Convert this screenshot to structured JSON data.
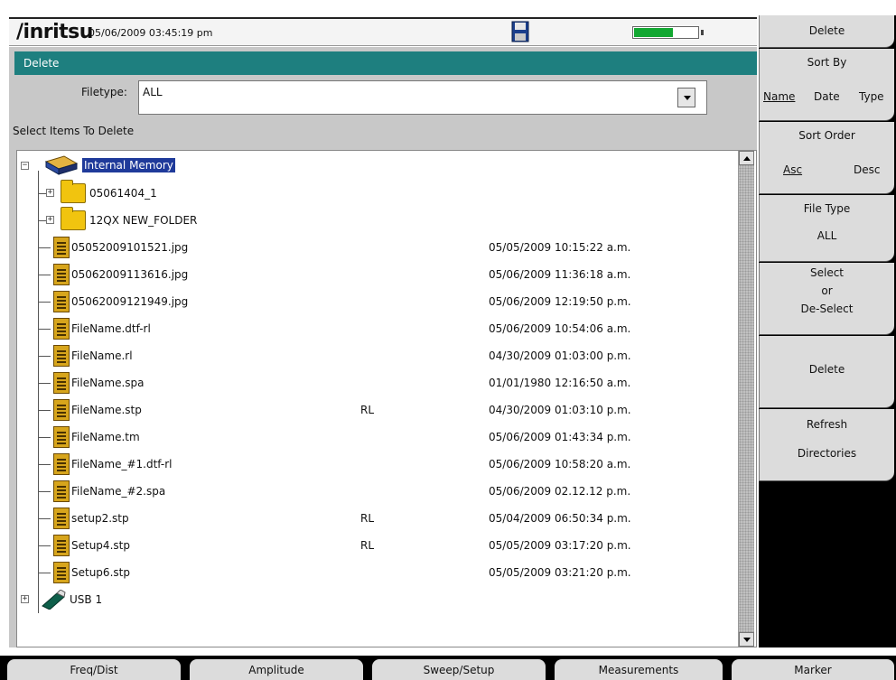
{
  "status": {
    "brand": "/inritsu",
    "datetime": "05/06/2009 03:45:19 pm",
    "battery_level_percent": 62
  },
  "header": {
    "title": "Delete",
    "filetype_label": "Filetype:",
    "filetype_value": "ALL",
    "select_prompt": "Select Items To Delete"
  },
  "tree": {
    "root": "Internal Memory",
    "folders": [
      "05061404_1",
      "12QX NEW_FOLDER"
    ],
    "files": [
      {
        "name": "05052009101521.jpg",
        "type": "",
        "date": "05/05/2009 10:15:22 a.m."
      },
      {
        "name": "05062009113616.jpg",
        "type": "",
        "date": "05/06/2009 11:36:18 a.m."
      },
      {
        "name": "05062009121949.jpg",
        "type": "",
        "date": "05/06/2009 12:19:50 p.m."
      },
      {
        "name": "FileName.dtf-rl",
        "type": "",
        "date": "05/06/2009 10:54:06 a.m."
      },
      {
        "name": "FileName.rl",
        "type": "",
        "date": "04/30/2009 01:03:00 p.m."
      },
      {
        "name": "FileName.spa",
        "type": "",
        "date": "01/01/1980 12:16:50 a.m."
      },
      {
        "name": "FileName.stp",
        "type": "RL",
        "date": "04/30/2009 01:03:10 p.m."
      },
      {
        "name": "FileName.tm",
        "type": "",
        "date": "05/06/2009 01:43:34 p.m."
      },
      {
        "name": "FileName_#1.dtf-rl",
        "type": "",
        "date": "05/06/2009 10:58:20 a.m."
      },
      {
        "name": "FileName_#2.spa",
        "type": "",
        "date": "05/06/2009 02.12.12 p.m."
      },
      {
        "name": "setup2.stp",
        "type": "RL",
        "date": "05/04/2009 06:50:34 p.m."
      },
      {
        "name": "Setup4.stp",
        "type": "RL",
        "date": "05/05/2009 03:17:20 p.m."
      },
      {
        "name": "Setup6.stp",
        "type": "",
        "date": "05/05/2009 03:21:20 p.m."
      }
    ],
    "usb": "USB 1"
  },
  "softkeys": {
    "delete_title": "Delete",
    "sort_by": {
      "title": "Sort By",
      "options": [
        "Name",
        "Date",
        "Type"
      ]
    },
    "sort_order": {
      "title": "Sort Order",
      "options": [
        "Asc",
        "Desc"
      ]
    },
    "file_type": {
      "title": "File Type",
      "value": "ALL"
    },
    "select": [
      "Select",
      "or",
      "De-Select"
    ],
    "delete": "Delete",
    "refresh": [
      "Refresh",
      "Directories"
    ]
  },
  "bottom_tabs": [
    "Freq/Dist",
    "Amplitude",
    "Sweep/Setup",
    "Measurements",
    "Marker"
  ],
  "colors": {
    "title_bar": "#1e7f7f",
    "selection": "#1f3a9a",
    "battery": "#13a832",
    "file_icon": "#d7a51c",
    "folder_icon": "#f1c40f"
  }
}
